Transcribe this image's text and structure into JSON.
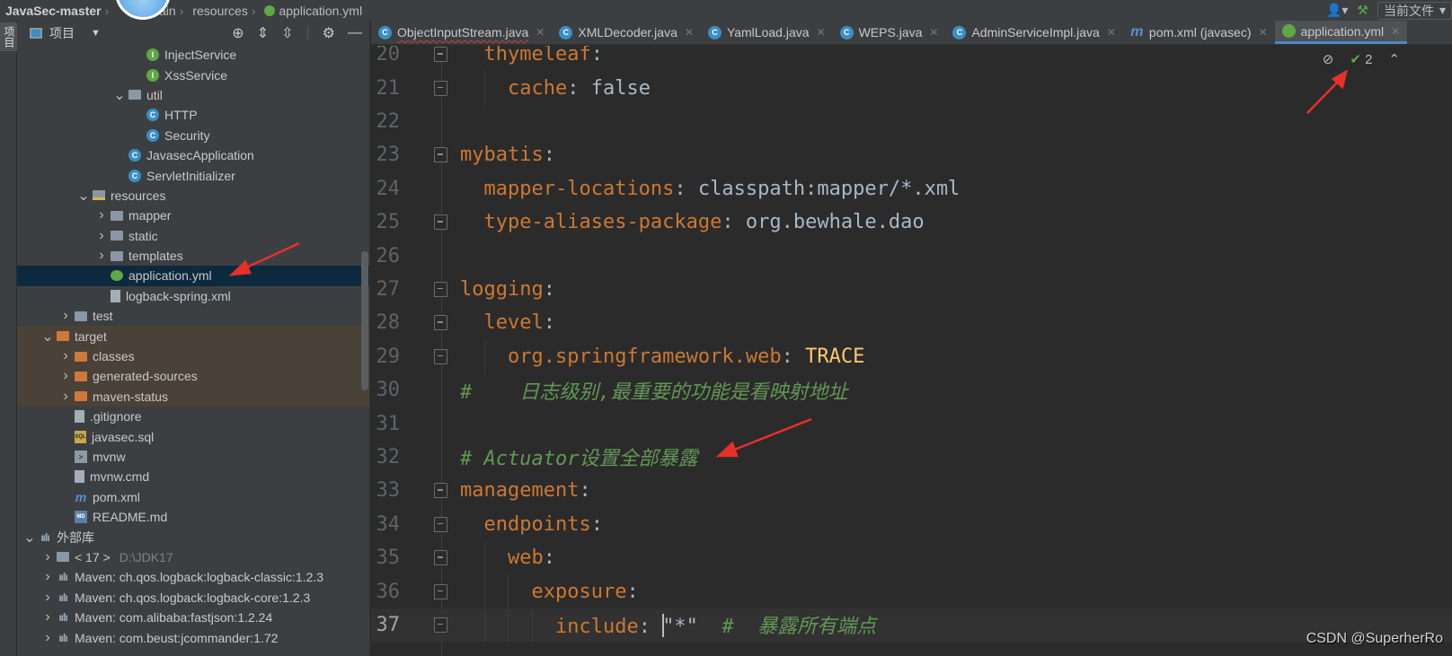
{
  "breadcrumb": [
    "JavaSec-master",
    "main",
    "resources",
    "application.yml"
  ],
  "topbar": {
    "current_file": "当前文件"
  },
  "left_strip": {
    "project_label": "项目"
  },
  "panel": {
    "title": "项目"
  },
  "tree": [
    {
      "label": "InjectService",
      "level": 6,
      "icon": "i"
    },
    {
      "label": "XssService",
      "level": 6,
      "icon": "i"
    },
    {
      "label": "util",
      "level": 5,
      "icon": "folder",
      "arrow": "open"
    },
    {
      "label": "HTTP",
      "level": 6,
      "icon": "c"
    },
    {
      "label": "Security",
      "level": 6,
      "icon": "c"
    },
    {
      "label": "JavasecApplication",
      "level": 5,
      "icon": "c"
    },
    {
      "label": "ServletInitializer",
      "level": 5,
      "icon": "c"
    },
    {
      "label": "resources",
      "level": 3,
      "icon": "res",
      "arrow": "open"
    },
    {
      "label": "mapper",
      "level": 4,
      "icon": "folder",
      "arrow": "closed"
    },
    {
      "label": "static",
      "level": 4,
      "icon": "folder",
      "arrow": "closed"
    },
    {
      "label": "templates",
      "level": 4,
      "icon": "folder",
      "arrow": "closed"
    },
    {
      "label": "application.yml",
      "level": 4,
      "icon": "spring",
      "selected": true
    },
    {
      "label": "logback-spring.xml",
      "level": 4,
      "icon": "file"
    },
    {
      "label": "test",
      "level": 2,
      "icon": "folder",
      "arrow": "closed"
    },
    {
      "label": "target",
      "level": 1,
      "icon": "folder-o",
      "arrow": "open",
      "excluded": true
    },
    {
      "label": "classes",
      "level": 2,
      "icon": "folder-o",
      "arrow": "closed",
      "excluded": true
    },
    {
      "label": "generated-sources",
      "level": 2,
      "icon": "folder-o",
      "arrow": "closed",
      "excluded": true
    },
    {
      "label": "maven-status",
      "level": 2,
      "icon": "folder-o",
      "arrow": "closed",
      "excluded": true
    },
    {
      "label": ".gitignore",
      "level": 2,
      "icon": "file"
    },
    {
      "label": "javasec.sql",
      "level": 2,
      "icon": "sql"
    },
    {
      "label": "mvnw",
      "level": 2,
      "icon": "term"
    },
    {
      "label": "mvnw.cmd",
      "level": 2,
      "icon": "file"
    },
    {
      "label": "pom.xml",
      "level": 2,
      "icon": "m"
    },
    {
      "label": "README.md",
      "level": 2,
      "icon": "md"
    },
    {
      "label": "外部库",
      "level": 0,
      "icon": "lib",
      "arrow": "open"
    },
    {
      "label": "< 17 >",
      "level": 1,
      "icon": "folder",
      "arrow": "closed",
      "extra": "D:\\JDK17"
    },
    {
      "label": "Maven: ch.qos.logback:logback-classic:1.2.3",
      "level": 1,
      "icon": "lib",
      "arrow": "closed"
    },
    {
      "label": "Maven: ch.qos.logback:logback-core:1.2.3",
      "level": 1,
      "icon": "lib",
      "arrow": "closed"
    },
    {
      "label": "Maven: com.alibaba:fastjson:1.2.24",
      "level": 1,
      "icon": "lib",
      "arrow": "closed"
    },
    {
      "label": "Maven: com.beust:jcommander:1.72",
      "level": 1,
      "icon": "lib",
      "arrow": "closed"
    }
  ],
  "tabs": [
    {
      "label": "ObjectInputStream.java",
      "icon": "c",
      "squiggle": true
    },
    {
      "label": "XMLDecoder.java",
      "icon": "c"
    },
    {
      "label": "YamlLoad.java",
      "icon": "c"
    },
    {
      "label": "WEPS.java",
      "icon": "c"
    },
    {
      "label": "AdminServiceImpl.java",
      "icon": "c"
    },
    {
      "label": "pom.xml (javasec)",
      "icon": "m"
    },
    {
      "label": "application.yml",
      "icon": "s",
      "active": true
    }
  ],
  "editor_tools": {
    "problems_count": "2"
  },
  "code": [
    {
      "n": "20",
      "fold": "open",
      "tokens": [
        [
          "p",
          "  "
        ],
        [
          "k",
          "thymeleaf"
        ],
        [
          "p",
          ":"
        ]
      ]
    },
    {
      "n": "21",
      "fold": "close",
      "tokens": [
        [
          "p",
          "    "
        ],
        [
          "k",
          "cache"
        ],
        [
          "p",
          ": false"
        ]
      ]
    },
    {
      "n": "22",
      "tokens": []
    },
    {
      "n": "23",
      "fold": "open",
      "tokens": [
        [
          "k",
          "mybatis"
        ],
        [
          "p",
          ":"
        ]
      ]
    },
    {
      "n": "24",
      "tokens": [
        [
          "p",
          "  "
        ],
        [
          "k",
          "mapper-locations"
        ],
        [
          "p",
          ": classpath:mapper/*.xml"
        ]
      ]
    },
    {
      "n": "25",
      "fold": "close",
      "tokens": [
        [
          "p",
          "  "
        ],
        [
          "k",
          "type-aliases-package"
        ],
        [
          "p",
          ": org.bewhale.dao"
        ]
      ]
    },
    {
      "n": "26",
      "tokens": []
    },
    {
      "n": "27",
      "fold": "open",
      "tokens": [
        [
          "k",
          "logging"
        ],
        [
          "p",
          ":"
        ]
      ]
    },
    {
      "n": "28",
      "fold": "open",
      "tokens": [
        [
          "p",
          "  "
        ],
        [
          "k",
          "level"
        ],
        [
          "p",
          ":"
        ]
      ]
    },
    {
      "n": "29",
      "fold": "close",
      "tokens": [
        [
          "p",
          "    "
        ],
        [
          "k",
          "org.springframework.web"
        ],
        [
          "p",
          ": "
        ],
        [
          "cs",
          "TRACE"
        ]
      ]
    },
    {
      "n": "30",
      "tokens": [
        [
          "cm",
          "#    日志级别,最重要的功能是看映射地址"
        ]
      ]
    },
    {
      "n": "31",
      "tokens": []
    },
    {
      "n": "32",
      "tokens": [
        [
          "cm",
          "# Actuator设置全部暴露"
        ]
      ]
    },
    {
      "n": "33",
      "fold": "open",
      "tokens": [
        [
          "k",
          "management"
        ],
        [
          "p",
          ":"
        ]
      ]
    },
    {
      "n": "34",
      "fold": "open",
      "tokens": [
        [
          "p",
          "  "
        ],
        [
          "k",
          "endpoints"
        ],
        [
          "p",
          ":"
        ]
      ]
    },
    {
      "n": "35",
      "fold": "open",
      "tokens": [
        [
          "p",
          "    "
        ],
        [
          "k",
          "web"
        ],
        [
          "p",
          ":"
        ]
      ]
    },
    {
      "n": "36",
      "fold": "open",
      "tokens": [
        [
          "p",
          "      "
        ],
        [
          "k",
          "exposure"
        ],
        [
          "p",
          ":"
        ]
      ]
    },
    {
      "n": "37",
      "fold": "close",
      "current": true,
      "tokens": [
        [
          "p",
          "        "
        ],
        [
          "k",
          "include"
        ],
        [
          "p",
          ": "
        ],
        [
          "st",
          "\"*\""
        ],
        [
          "p",
          "  "
        ],
        [
          "cm",
          "#  暴露所有端点"
        ]
      ]
    }
  ],
  "watermark": "CSDN @SuperherRo",
  "colors": {
    "keyword": "#cc7832",
    "comment": "#629755",
    "selection": "#0d293e",
    "excluded": "#4a4138",
    "tab_accent": "#4a88c7",
    "annotation": "#e8302a"
  }
}
